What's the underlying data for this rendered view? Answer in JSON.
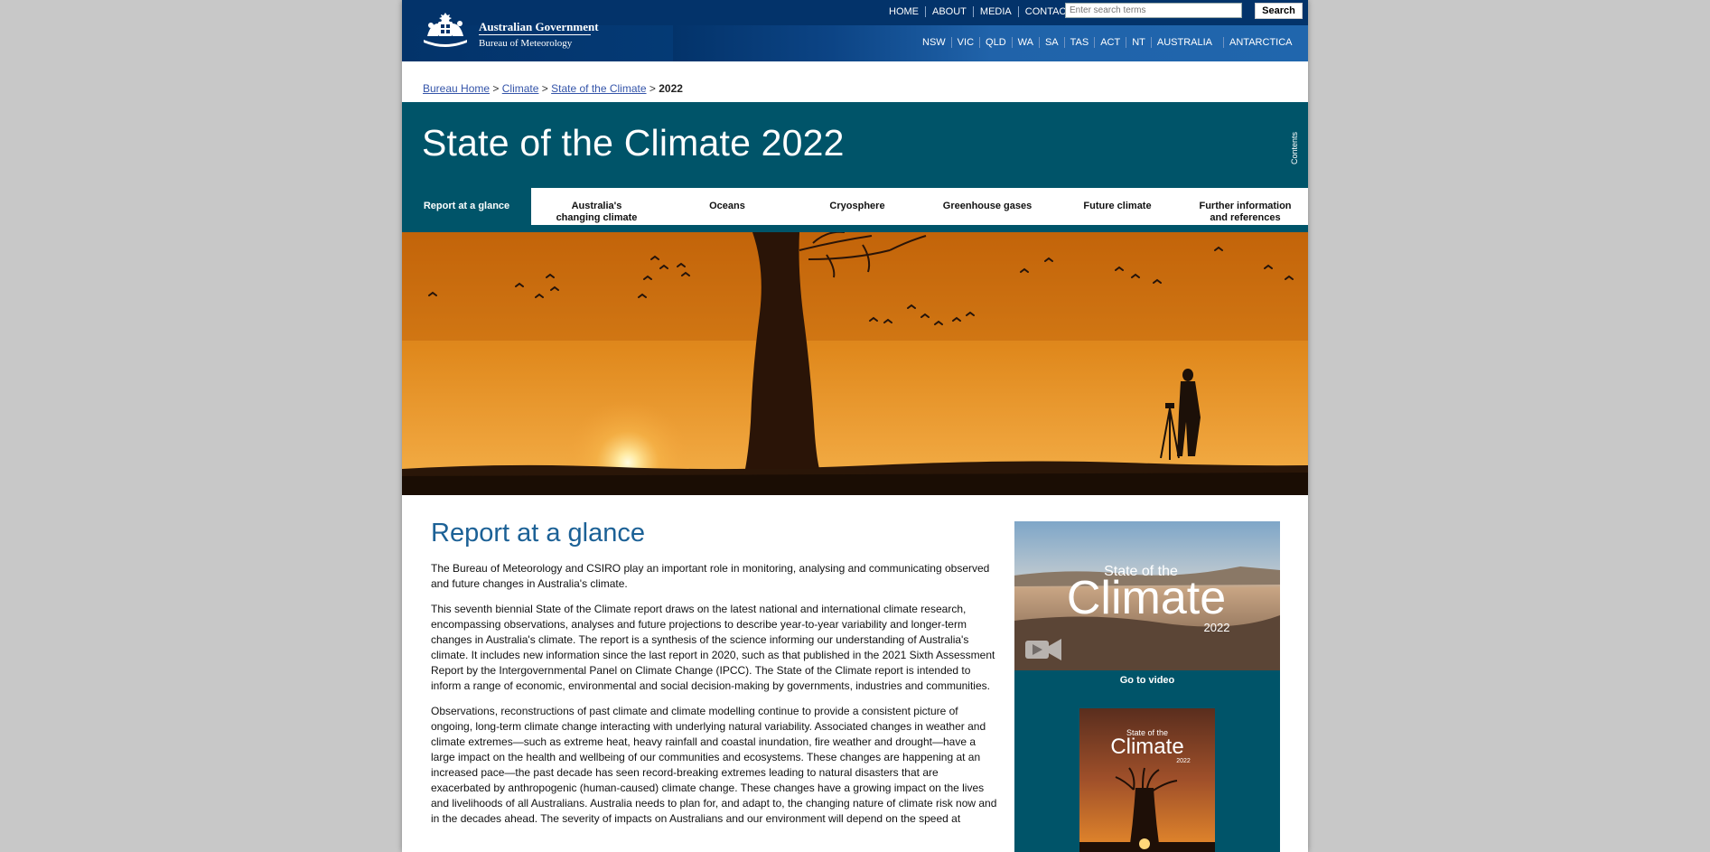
{
  "header": {
    "gov_name": "Australian Government",
    "agency_name": "Bureau of Meteorology",
    "top_links": [
      "HOME",
      "ABOUT",
      "MEDIA",
      "CONTACTS"
    ],
    "search_placeholder": "Enter search terms",
    "search_button": "Search",
    "state_links": [
      "NSW",
      "VIC",
      "QLD",
      "WA",
      "SA",
      "TAS",
      "ACT",
      "NT",
      "AUSTRALIA",
      "ANTARCTICA"
    ]
  },
  "breadcrumb": {
    "items": [
      "Bureau Home",
      "Climate",
      "State of the Climate"
    ],
    "separator": ">",
    "current": "2022"
  },
  "banner": {
    "title": "State of the Climate 2022",
    "contents_label": "Contents",
    "tabs": [
      {
        "label": "Report at a glance",
        "active": true
      },
      {
        "label": "Australia's changing climate"
      },
      {
        "label": "Oceans"
      },
      {
        "label": "Cryosphere"
      },
      {
        "label": "Greenhouse gases"
      },
      {
        "label": "Future climate"
      },
      {
        "label": "Further information and references"
      }
    ]
  },
  "main": {
    "heading": "Report at a glance",
    "paragraphs": [
      "The Bureau of Meteorology and CSIRO play an important role in monitoring, analysing and communicating observed and future changes in Australia's climate.",
      "This seventh biennial State of the Climate report draws on the latest national and international climate research, encompassing observations, analyses and future projections to describe year-to-year variability and longer-term changes in Australia's climate. The report is a synthesis of the science informing our understanding of Australia's climate. It includes new information since the last report in 2020, such as that published in the 2021 Sixth Assessment Report by the Intergovernmental Panel on Climate Change (IPCC). The State of the Climate report is intended to inform a range of economic, environmental and social decision-making by governments, industries and communities.",
      "Observations, reconstructions of past climate and climate modelling continue to provide a consistent picture of ongoing, long-term climate change interacting with underlying natural variability. Associated changes in weather and climate extremes—such as extreme heat, heavy rainfall and coastal inundation, fire weather and drought—have a large impact on the health and wellbeing of our communities and ecosystems. These changes are happening at an increased pace—the past decade has seen record-breaking extremes leading to natural disasters that are exacerbated by anthropogenic (human-caused) climate change. These changes have a growing impact on the lives and livelihoods of all Australians. Australia needs to plan for, and adapt to, the changing nature of climate risk now and in the decades ahead. The severity of impacts on Australians and our environment will depend on the speed at"
    ]
  },
  "sidebar": {
    "video_title_small": "State of the",
    "video_title_large": "Climate",
    "video_year": "2022",
    "video_link": "Go to video",
    "cover_title_small": "State of the",
    "cover_title_large": "Climate",
    "cover_year": "2022"
  },
  "colors": {
    "banner_teal": "#005469",
    "header_navy": "#03336a",
    "heading_blue": "#1c6196",
    "link_blue": "#3454a9"
  }
}
